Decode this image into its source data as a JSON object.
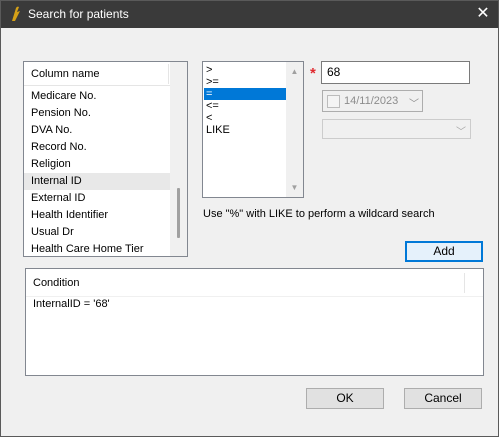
{
  "window": {
    "title": "Search for patients",
    "close_icon": "✕"
  },
  "column_list": {
    "header": "Column name",
    "items": [
      "Medicare No.",
      "Pension No.",
      "DVA No.",
      "Record No.",
      "Religion",
      "Internal ID",
      "External ID",
      "Health Identifier",
      "Usual Dr",
      "Health Care Home Tier"
    ],
    "highlighted_item": "Internal ID"
  },
  "operators": {
    "items": [
      ">",
      ">=",
      "=",
      "<=",
      "<",
      "LIKE"
    ],
    "selected": "="
  },
  "value": {
    "text": "68",
    "required_mark": "*"
  },
  "date": {
    "value": "14/11/2023",
    "checked": false
  },
  "hint": "Use \"%\" with LIKE to perform a wildcard search",
  "buttons": {
    "add": "Add",
    "ok": "OK",
    "cancel": "Cancel"
  },
  "condition": {
    "header": "Condition",
    "rows": [
      "InternalID = '68'"
    ]
  }
}
